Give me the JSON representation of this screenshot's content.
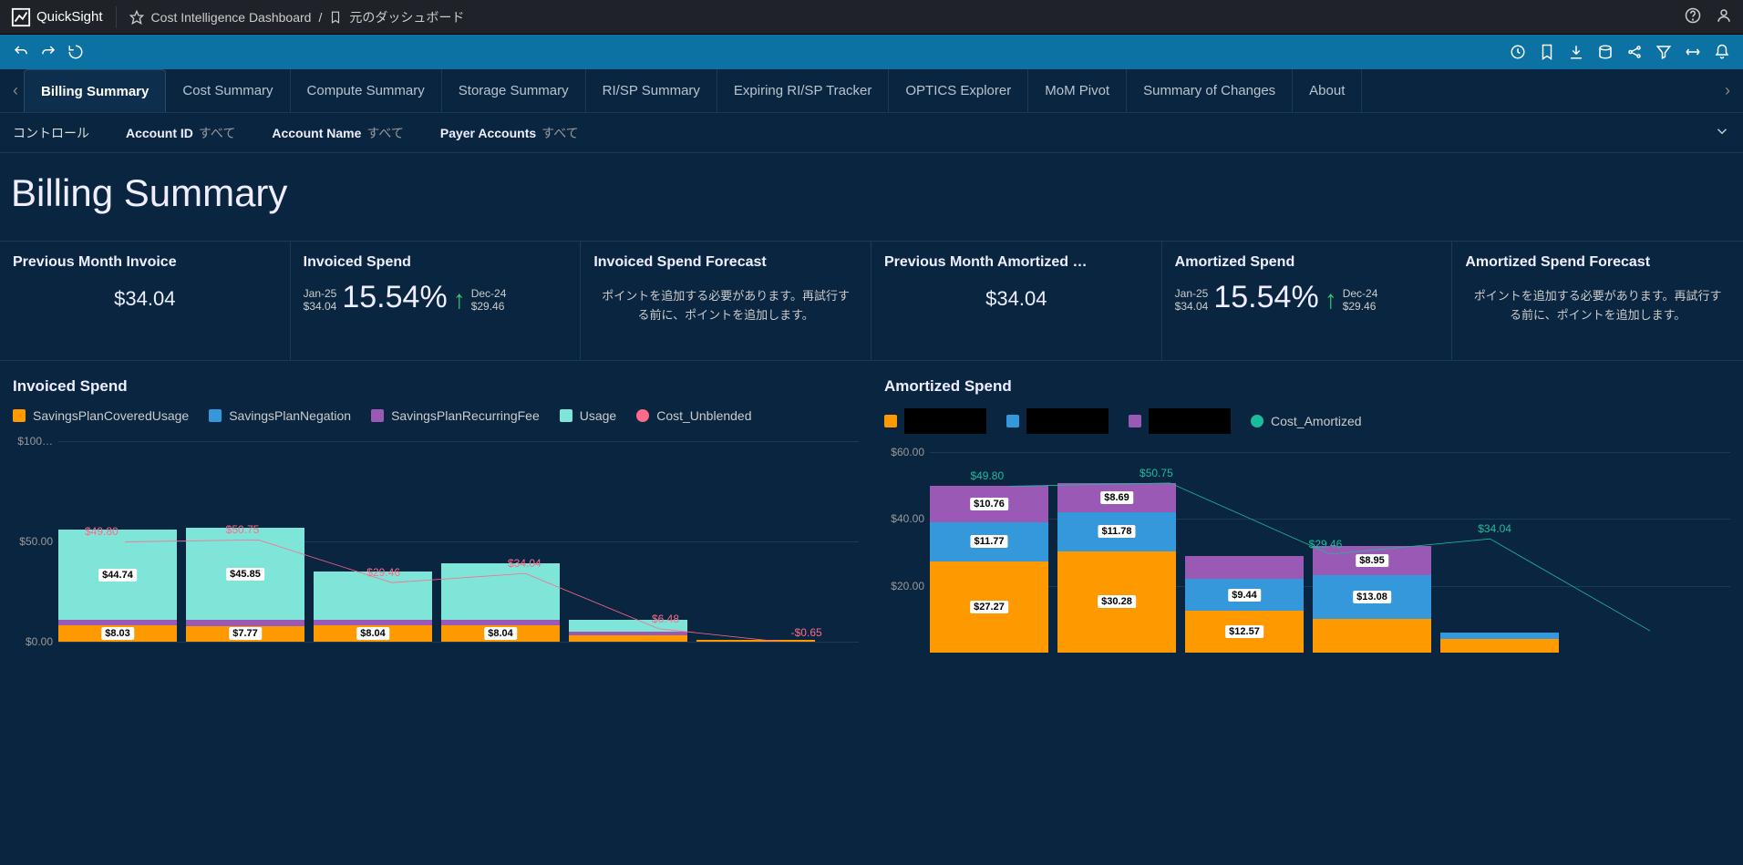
{
  "app": {
    "name": "QuickSight"
  },
  "breadcrumb": {
    "dashboard": "Cost Intelligence Dashboard",
    "sep": "/",
    "original": "元のダッシュボード"
  },
  "tabs": [
    "Billing Summary",
    "Cost Summary",
    "Compute Summary",
    "Storage Summary",
    "RI/SP Summary",
    "Expiring RI/SP Tracker",
    "OPTICS Explorer",
    "MoM Pivot",
    "Summary of Changes",
    "About"
  ],
  "activeTab": 0,
  "controls": {
    "label": "コントロール",
    "filters": [
      {
        "name": "Account ID",
        "value": "すべて"
      },
      {
        "name": "Account Name",
        "value": "すべて"
      },
      {
        "name": "Payer Accounts",
        "value": "すべて"
      }
    ]
  },
  "pageTitle": "Billing Summary",
  "kpi": [
    {
      "title": "Previous Month Invoice",
      "type": "single",
      "value": "$34.04"
    },
    {
      "title": "Invoiced Spend",
      "type": "trend",
      "cur": {
        "period": "Jan-25",
        "value": "$34.04"
      },
      "pct": "15.54%",
      "prev": {
        "period": "Dec-24",
        "value": "$29.46"
      }
    },
    {
      "title": "Invoiced Spend Forecast",
      "type": "msg",
      "msg": "ポイントを追加する必要があります。再試行する前に、ポイントを追加します。"
    },
    {
      "title": "Previous Month Amortized …",
      "type": "single",
      "value": "$34.04"
    },
    {
      "title": "Amortized Spend",
      "type": "trend",
      "cur": {
        "period": "Jan-25",
        "value": "$34.04"
      },
      "pct": "15.54%",
      "prev": {
        "period": "Dec-24",
        "value": "$29.46"
      }
    },
    {
      "title": "Amortized Spend Forecast",
      "type": "msg",
      "msg": "ポイントを追加する必要があります。再試行する前に、ポイントを追加します。"
    }
  ],
  "colors": {
    "orange": "#ff9900",
    "blue": "#3498db",
    "purple": "#9b59b6",
    "teal": "#7fe5d9",
    "pink": "#ff6b8a",
    "tealLine": "#1abc9c"
  },
  "charts": {
    "invoiced": {
      "title": "Invoiced Spend",
      "legend": [
        {
          "label": "SavingsPlanCoveredUsage",
          "color": "orange",
          "shape": "sq"
        },
        {
          "label": "SavingsPlanNegation",
          "color": "blue",
          "shape": "sq"
        },
        {
          "label": "SavingsPlanRecurringFee",
          "color": "purple",
          "shape": "sq"
        },
        {
          "label": "Usage",
          "color": "teal",
          "shape": "sq"
        },
        {
          "label": "Cost_Unblended",
          "color": "pink",
          "shape": "round"
        }
      ]
    },
    "amortized": {
      "title": "Amortized Spend",
      "legend": [
        {
          "label": "",
          "color": "orange",
          "redact": true
        },
        {
          "label": "",
          "color": "blue",
          "redact": true
        },
        {
          "label": "",
          "color": "purple",
          "redact": true
        },
        {
          "label": "Cost_Amortized",
          "color": "tealLine",
          "shape": "round"
        }
      ]
    }
  },
  "chart_data": [
    {
      "id": "invoiced",
      "type": "bar",
      "stacked": true,
      "yticks": [
        "$100…",
        "$50.00",
        "$0.00"
      ],
      "ylim": [
        0,
        100
      ],
      "line_series": {
        "name": "Cost_Unblended",
        "color": "pink",
        "values": [
          49.8,
          50.75,
          29.46,
          34.04,
          6.48,
          -0.65
        ]
      },
      "line_labels": [
        "$49.80",
        "$50.75",
        "$29.46",
        "$34.04",
        "$6.48",
        "-$0.65"
      ],
      "bars": [
        {
          "segs": [
            {
              "k": "orange",
              "v": 8.03,
              "lbl": "$8.03"
            },
            {
              "k": "purple",
              "v": 3
            },
            {
              "k": "teal",
              "v": 44.74,
              "lbl": "$44.74"
            }
          ]
        },
        {
          "segs": [
            {
              "k": "orange",
              "v": 7.77,
              "lbl": "$7.77"
            },
            {
              "k": "purple",
              "v": 3
            },
            {
              "k": "teal",
              "v": 45.85,
              "lbl": "$45.85"
            }
          ]
        },
        {
          "segs": [
            {
              "k": "orange",
              "v": 8.04,
              "lbl": "$8.04"
            },
            {
              "k": "purple",
              "v": 3
            },
            {
              "k": "teal",
              "v": 24
            }
          ]
        },
        {
          "segs": [
            {
              "k": "orange",
              "v": 8.04,
              "lbl": "$8.04"
            },
            {
              "k": "purple",
              "v": 3
            },
            {
              "k": "teal",
              "v": 28
            }
          ]
        },
        {
          "segs": [
            {
              "k": "orange",
              "v": 3
            },
            {
              "k": "purple",
              "v": 2
            },
            {
              "k": "teal",
              "v": 6
            }
          ]
        },
        {
          "segs": [
            {
              "k": "orange",
              "v": 1
            }
          ]
        }
      ]
    },
    {
      "id": "amortized",
      "type": "bar",
      "stacked": true,
      "yticks": [
        "$60.00",
        "$40.00",
        "$20.00"
      ],
      "ylim": [
        0,
        60
      ],
      "line_series": {
        "name": "Cost_Amortized",
        "color": "tealLine",
        "values": [
          49.8,
          50.75,
          29.46,
          34.04,
          6.5
        ]
      },
      "line_labels": [
        "$49.80",
        "$50.75",
        "$29.46",
        "$34.04",
        ""
      ],
      "bars": [
        {
          "segs": [
            {
              "k": "orange",
              "v": 27.27,
              "lbl": "$27.27"
            },
            {
              "k": "blue",
              "v": 11.77,
              "lbl": "$11.77"
            },
            {
              "k": "purple",
              "v": 10.76,
              "lbl": "$10.76"
            }
          ]
        },
        {
          "segs": [
            {
              "k": "orange",
              "v": 30.28,
              "lbl": "$30.28"
            },
            {
              "k": "blue",
              "v": 11.78,
              "lbl": "$11.78"
            },
            {
              "k": "purple",
              "v": 8.69,
              "lbl": "$8.69"
            }
          ]
        },
        {
          "segs": [
            {
              "k": "orange",
              "v": 12.57,
              "lbl": "$12.57"
            },
            {
              "k": "blue",
              "v": 9.44,
              "lbl": "$9.44"
            },
            {
              "k": "purple",
              "v": 7
            }
          ]
        },
        {
          "segs": [
            {
              "k": "orange",
              "v": 10
            },
            {
              "k": "blue",
              "v": 13.08,
              "lbl": "$13.08"
            },
            {
              "k": "purple",
              "v": 8.95,
              "lbl": "$8.95"
            }
          ]
        },
        {
          "segs": [
            {
              "k": "orange",
              "v": 4
            },
            {
              "k": "blue",
              "v": 2
            }
          ]
        }
      ]
    }
  ]
}
